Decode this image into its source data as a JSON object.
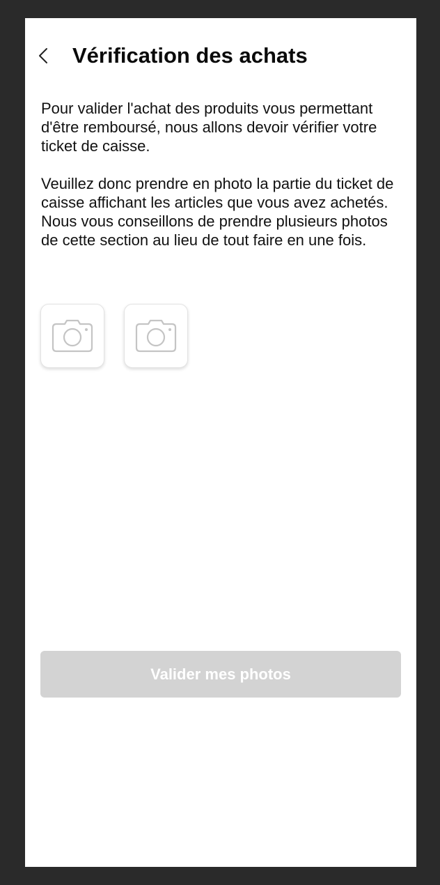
{
  "header": {
    "back_icon": "chevron-left-icon",
    "title": "Vérification des achats"
  },
  "instructions": {
    "paragraph_1": "Pour valider l'achat des produits vous permettant d'être remboursé, nous allons devoir vérifier votre ticket de caisse.",
    "paragraph_2": "Veuillez donc prendre en photo la partie du ticket de caisse affichant les articles que vous avez achetés. Nous vous conseillons de prendre plusieurs photos de cette section au lieu de tout faire en une fois."
  },
  "photo_slots": [
    {
      "icon": "camera-icon"
    },
    {
      "icon": "camera-icon"
    }
  ],
  "submit": {
    "label": "Valider mes photos",
    "state": "disabled"
  },
  "colors": {
    "frame_background": "#2a2a2a",
    "screen_background": "#ffffff",
    "button_disabled": "#d3d3d3",
    "icon_gray": "#c4c4c4"
  }
}
